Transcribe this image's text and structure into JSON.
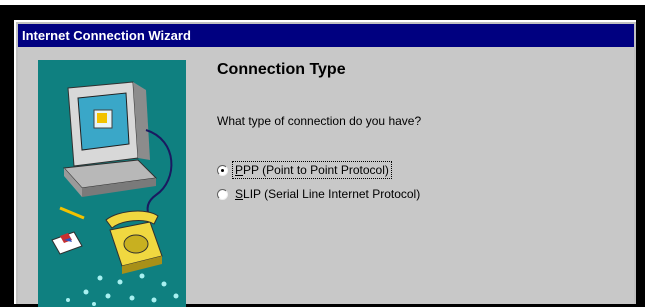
{
  "window": {
    "title": "Internet Connection Wizard"
  },
  "page": {
    "heading": "Connection Type",
    "question": "What type of connection do you have?"
  },
  "options": [
    {
      "mnemonic": "P",
      "rest": "PP (Point to Point Protocol)",
      "selected": true
    },
    {
      "mnemonic": "S",
      "rest": "LIP (Serial Line Internet Protocol)",
      "selected": false
    }
  ],
  "colors": {
    "titlebar": "#000080",
    "panel": "#0f8080",
    "dialog": "#c8c8c8"
  },
  "illustration": {
    "icons": [
      "computer-monitor-icon",
      "telephone-icon",
      "envelope-icon",
      "network-dots"
    ]
  }
}
